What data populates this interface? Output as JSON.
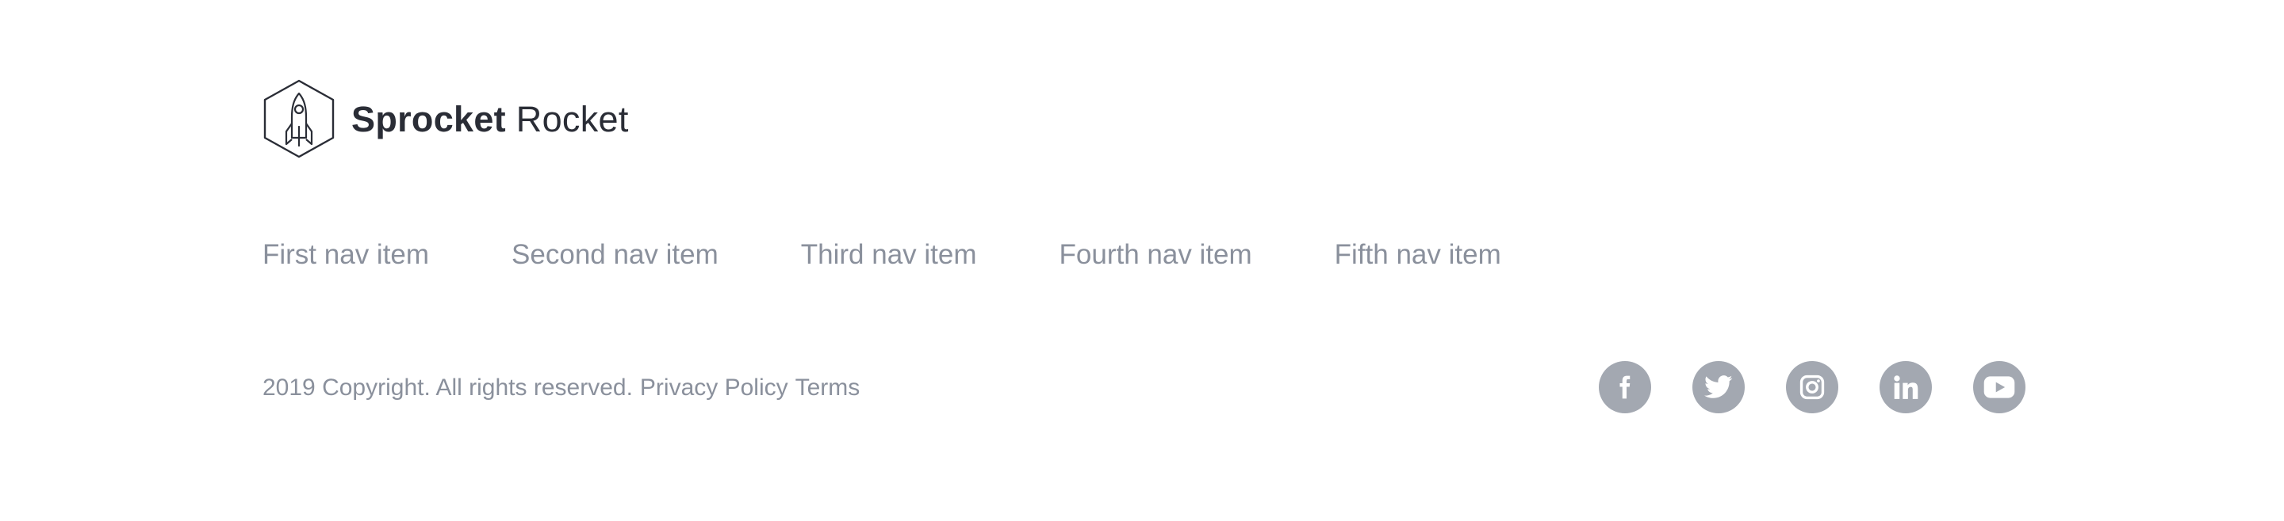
{
  "brand": {
    "name_bold": "Sprocket",
    "name_light": "Rocket",
    "icon": "rocket-hexagon-icon"
  },
  "nav": {
    "items": [
      {
        "label": "First nav item"
      },
      {
        "label": "Second nav item"
      },
      {
        "label": "Third nav item"
      },
      {
        "label": "Fourth nav item"
      },
      {
        "label": "Fifth nav item"
      }
    ]
  },
  "footer": {
    "copyright": "2019 Copyright. All rights reserved.",
    "privacy_label": "Privacy Policy",
    "terms_label": "Terms"
  },
  "social": {
    "icons": [
      "facebook-icon",
      "twitter-icon",
      "instagram-icon",
      "linkedin-icon",
      "youtube-icon"
    ],
    "button_color": "#a3a8b1"
  },
  "colors": {
    "text_dark": "#2a2d36",
    "text_muted": "#8a909c",
    "background": "#ffffff"
  }
}
